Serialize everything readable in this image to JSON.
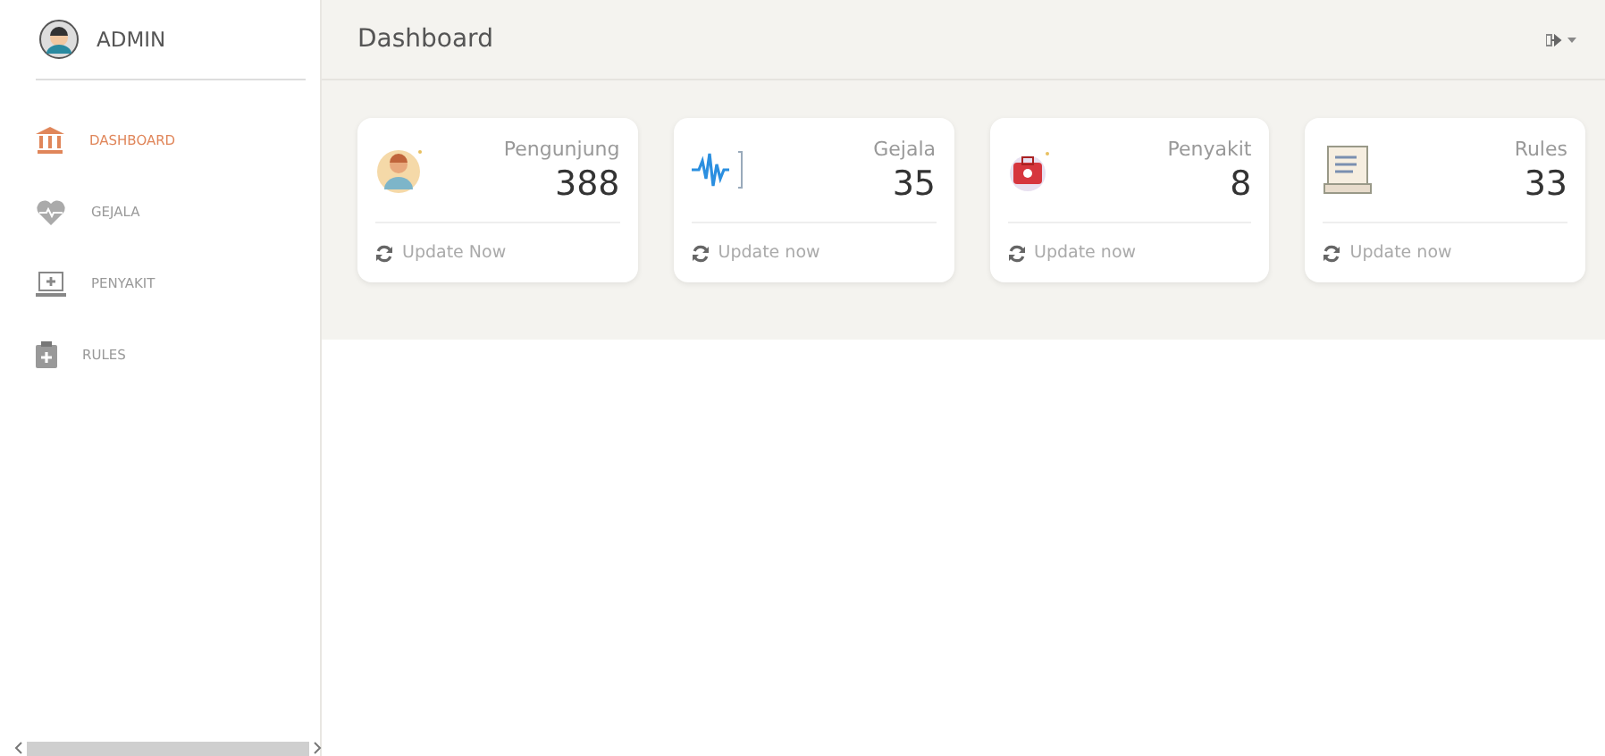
{
  "sidebar": {
    "user": "ADMIN",
    "items": [
      {
        "label": "DASHBOARD",
        "selected": true
      },
      {
        "label": "GEJALA",
        "selected": false
      },
      {
        "label": "PENYAKIT",
        "selected": false
      },
      {
        "label": "RULES",
        "selected": false
      }
    ]
  },
  "header": {
    "title": "Dashboard"
  },
  "cards": [
    {
      "label": "Pengunjung",
      "value": "388",
      "footer": "Update Now"
    },
    {
      "label": "Gejala",
      "value": "35",
      "footer": "Update now"
    },
    {
      "label": "Penyakit",
      "value": "8",
      "footer": "Update now"
    },
    {
      "label": "Rules",
      "value": "33",
      "footer": "Update now"
    }
  ]
}
